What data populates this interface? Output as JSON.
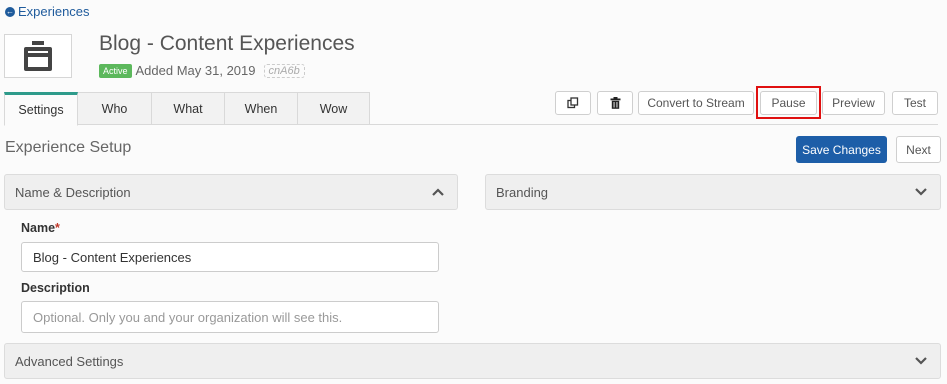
{
  "nav": {
    "back_label": "Experiences"
  },
  "header": {
    "title": "Blog - Content Experiences",
    "status": "Active",
    "added": "Added May 31, 2019",
    "code": "cnA6b"
  },
  "tabs": [
    {
      "label": "Settings",
      "active": true
    },
    {
      "label": "Who",
      "active": false
    },
    {
      "label": "What",
      "active": false
    },
    {
      "label": "When",
      "active": false
    },
    {
      "label": "Wow",
      "active": false
    }
  ],
  "toolbar": {
    "copy_icon": "copy-icon",
    "delete_icon": "trash-icon",
    "convert_label": "Convert to Stream",
    "pause_label": "Pause",
    "preview_label": "Preview",
    "test_label": "Test"
  },
  "setup": {
    "title": "Experience Setup",
    "save_label": "Save Changes",
    "next_label": "Next"
  },
  "panels": {
    "name_description": "Name & Description",
    "branding": "Branding",
    "advanced": "Advanced Settings"
  },
  "form": {
    "name_label": "Name",
    "name_required": "*",
    "name_value": "Blog - Content Experiences",
    "description_label": "Description",
    "description_placeholder": "Optional. Only you and your organization will see this."
  },
  "colors": {
    "accent_tab": "#2e9b8b",
    "primary": "#1d5ea8",
    "active_badge": "#5cb85c",
    "highlight": "#e01010"
  }
}
